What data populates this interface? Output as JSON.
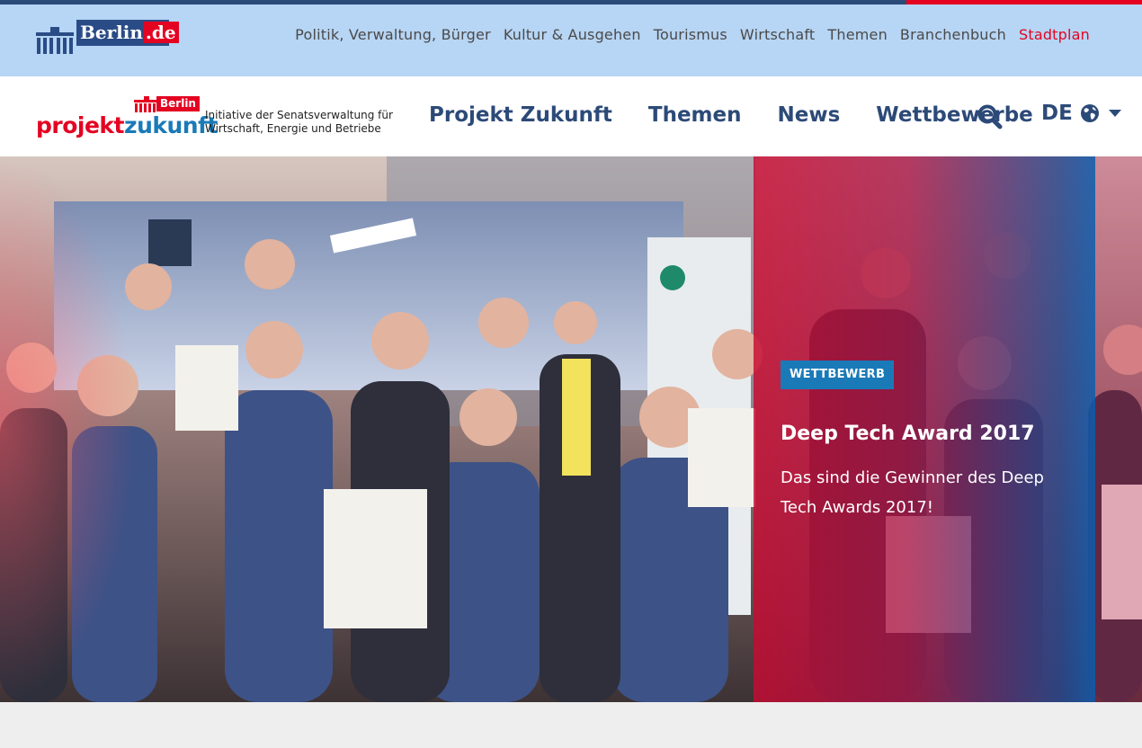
{
  "berlin_bar": {
    "logo_text": "Berlin",
    "logo_tld": ".de",
    "nav": [
      {
        "label": "Politik, Verwaltung, Bürger"
      },
      {
        "label": "Kultur & Ausgehen"
      },
      {
        "label": "Tourismus"
      },
      {
        "label": "Wirtschaft"
      },
      {
        "label": "Themen"
      },
      {
        "label": "Branchenbuch"
      },
      {
        "label": "Stadtplan",
        "active": true
      }
    ],
    "colors": {
      "bar": "#b7d5f4",
      "accent": "#e40422",
      "dark": "#2c4a78"
    }
  },
  "header": {
    "logo": {
      "berlin_tag": "Berlin",
      "word_part1": "projekt",
      "word_part2": "zukunft",
      "tagline": "Initiative der Senatsverwaltung für\nWirtschaft, Energie und Betriebe"
    },
    "nav": [
      {
        "label": "Projekt Zukunft"
      },
      {
        "label": "Themen"
      },
      {
        "label": "News"
      },
      {
        "label": "Wettbewerbe"
      }
    ],
    "search_icon": "search-icon",
    "language": {
      "code": "DE",
      "icon": "globe-icon"
    }
  },
  "hero": {
    "badge": "WETTBEWERB",
    "title": "Deep Tech Award 2017",
    "teaser": "Das sind die Gewinner des Deep Tech Awards 2017!",
    "colors": {
      "badge": "#1a7ab8",
      "overlay_start": "#c80a32",
      "overlay_end": "#145aaa"
    }
  }
}
